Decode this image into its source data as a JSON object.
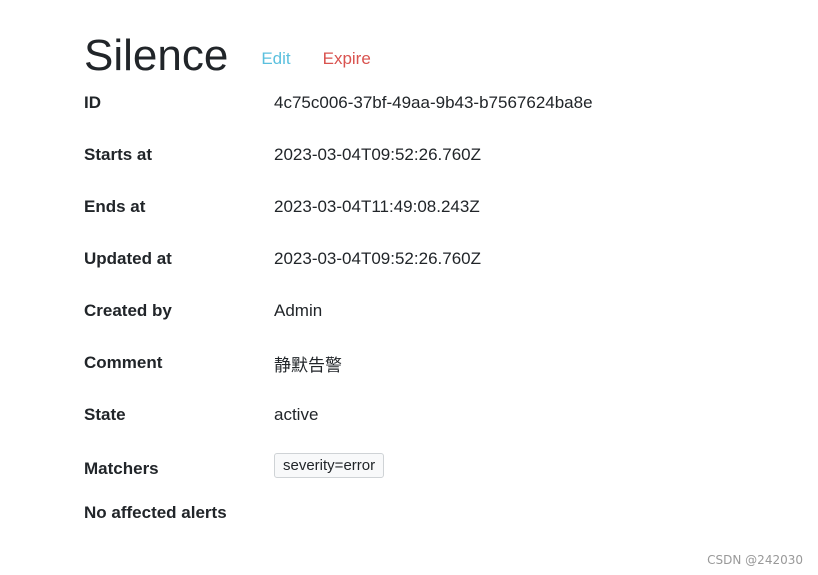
{
  "header": {
    "title": "Silence",
    "edit_label": "Edit",
    "expire_label": "Expire"
  },
  "fields": [
    {
      "label": "ID",
      "value": "4c75c006-37bf-49aa-9b43-b7567624ba8e"
    },
    {
      "label": "Starts at",
      "value": "2023-03-04T09:52:26.760Z"
    },
    {
      "label": "Ends at",
      "value": "2023-03-04T11:49:08.243Z"
    },
    {
      "label": "Updated at",
      "value": "2023-03-04T09:52:26.760Z"
    },
    {
      "label": "Created by",
      "value": "Admin"
    },
    {
      "label": "Comment",
      "value": "静默告警"
    },
    {
      "label": "State",
      "value": "active"
    }
  ],
  "matchers": {
    "label": "Matchers",
    "items": [
      "severity=error"
    ]
  },
  "affected": {
    "label": "No affected alerts"
  },
  "watermark": "CSDN @242030",
  "colors": {
    "edit": "#5bc0de",
    "expire": "#d9534f",
    "text": "#212529"
  }
}
